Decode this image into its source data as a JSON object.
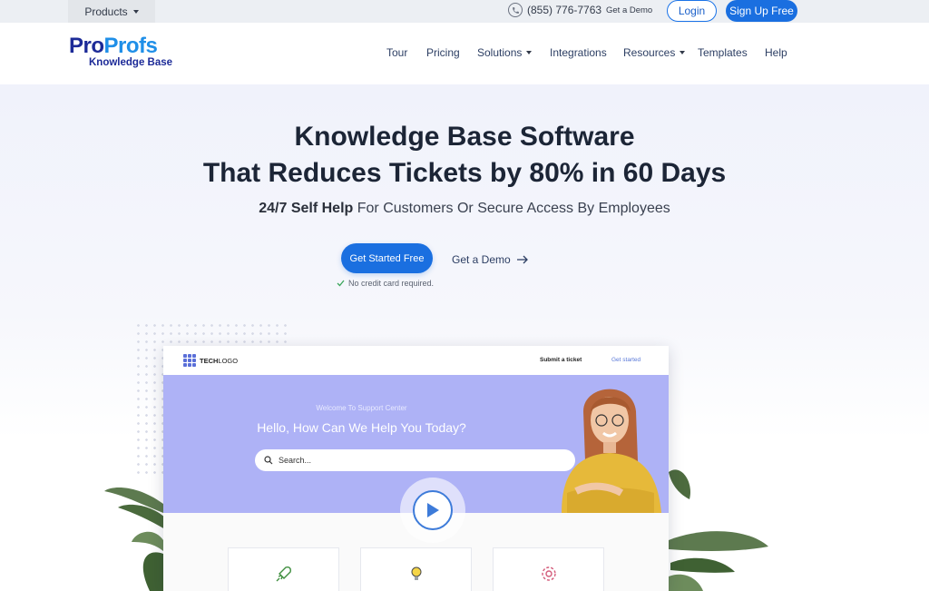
{
  "topbar": {
    "products_label": "Products",
    "phone": "(855) 776-7763",
    "demo_label": "Get a Demo",
    "login_label": "Login",
    "signup_label": "Sign Up Free"
  },
  "nav": {
    "logo_pro": "Pro",
    "logo_profs": "Profs",
    "logo_sub": "Knowledge Base",
    "links": [
      {
        "label": "Tour",
        "dropdown": false
      },
      {
        "label": "Pricing",
        "dropdown": false
      },
      {
        "label": "Solutions",
        "dropdown": true
      },
      {
        "label": "Integrations",
        "dropdown": false
      },
      {
        "label": "Resources",
        "dropdown": true
      },
      {
        "label": "Templates",
        "dropdown": false
      },
      {
        "label": "Help",
        "dropdown": false
      }
    ]
  },
  "hero": {
    "headline_1": "Knowledge Base Software",
    "headline_2": "That Reduces Tickets by 80% in 60 Days",
    "subline_bold": "24/7 Self Help",
    "subline_rest": " For Customers Or Secure Access By Employees",
    "cta_primary": "Get Started Free",
    "cta_secondary": "Get a Demo",
    "no_card": "No credit card required."
  },
  "mockup": {
    "logo_tech": "TECH",
    "logo_rest": "LOGO",
    "submit_ticket": "Submit a ticket",
    "get_started": "Get started",
    "welcome": "Welcome To Support Center",
    "hello": "Hello, How Can We Help You Today?",
    "search_placeholder": "Search...",
    "cards": [
      "rocket-icon",
      "lightbulb-icon",
      "gear-icon"
    ]
  },
  "colors": {
    "brand_blue": "#1a6fe0",
    "logo_navy": "#1d2b98",
    "logo_light": "#1f8fe8",
    "banner_purple": "#aeb2f6"
  }
}
